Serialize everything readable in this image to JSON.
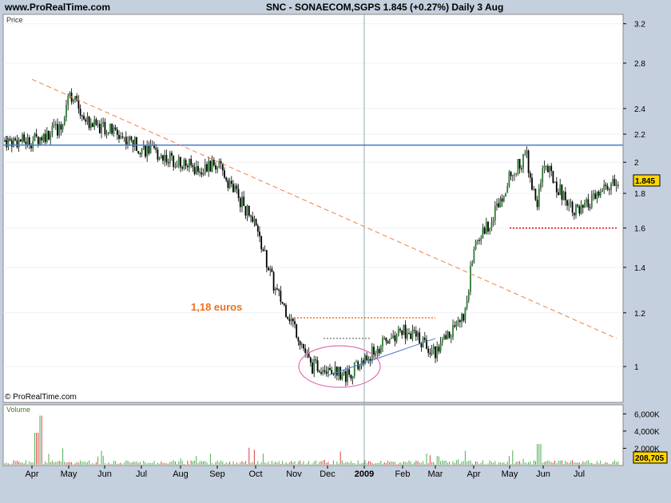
{
  "header": {
    "site": "www.ProRealTime.com",
    "symbol_line": "SNC - SONAECOM,SGPS    1.845 (+0.27%)    Daily  3 Aug"
  },
  "price_panel": {
    "label": "Price",
    "copyright": "© ProRealTime.com",
    "y_ticks": [
      "3.2",
      "2.8",
      "2.4",
      "2.2",
      "2",
      "1.8",
      "1.6",
      "1.4",
      "1.2",
      "1"
    ],
    "last_price": "1.845",
    "clipped_level_label": "2."
  },
  "volume_panel": {
    "label": "Volume",
    "y_ticks": [
      "6,000K",
      "4,000K",
      "2,000K"
    ],
    "last_volume": "208,705"
  },
  "x_axis": {
    "labels": [
      "Apr",
      "May",
      "Jun",
      "Jul",
      "Aug",
      "Sep",
      "Oct",
      "Nov",
      "Dec",
      "2009",
      "Feb",
      "Mar",
      "Apr",
      "May",
      "Jun",
      "Jul"
    ]
  },
  "annotations": {
    "support_label": "1,18 euros"
  },
  "colors": {
    "background": "#c5d0de",
    "panel": "#ffffff",
    "bull_candle": "#2e7d32",
    "horizontal_line": "#4a7bd0",
    "downtrend": "#f08040",
    "support": "#f07020",
    "resistance_dotted": "#e00000",
    "ellipse": "#e070b0",
    "volume_bar": "#4caf50",
    "volume_bar_alt": "#d84040",
    "last_price_box": "#ffd700"
  },
  "chart_data": {
    "type": "candlestick",
    "y_scale": "log",
    "ylim": [
      0.9,
      3.25
    ],
    "x_period": [
      "2008-04",
      "2009-08"
    ],
    "closing_path": [
      {
        "x": "Apr 2008",
        "y": 2.15
      },
      {
        "x": "late Apr 2008",
        "y": 2.25
      },
      {
        "x": "May 2008",
        "y": 2.55
      },
      {
        "x": "mid May 2008",
        "y": 2.3
      },
      {
        "x": "Jun 2008",
        "y": 2.25
      },
      {
        "x": "mid Jun 2008",
        "y": 2.18
      },
      {
        "x": "Jul 2008",
        "y": 2.1
      },
      {
        "x": "mid Jul 2008",
        "y": 2.05
      },
      {
        "x": "Aug 2008",
        "y": 2.0
      },
      {
        "x": "mid Aug 2008",
        "y": 1.95
      },
      {
        "x": "Sep 2008",
        "y": 1.98
      },
      {
        "x": "mid Sep 2008",
        "y": 1.8
      },
      {
        "x": "Oct 2008",
        "y": 1.6
      },
      {
        "x": "mid Oct 2008",
        "y": 1.3
      },
      {
        "x": "Nov 2008",
        "y": 1.15
      },
      {
        "x": "mid Nov 2008",
        "y": 1.0
      },
      {
        "x": "Dec 2008",
        "y": 1.0
      },
      {
        "x": "mid Dec 2008",
        "y": 0.97
      },
      {
        "x": "Jan 2009",
        "y": 1.02
      },
      {
        "x": "mid Jan 2009",
        "y": 1.08
      },
      {
        "x": "Feb 2009",
        "y": 1.13
      },
      {
        "x": "mid Feb 2009",
        "y": 1.1
      },
      {
        "x": "Mar 2009",
        "y": 1.05
      },
      {
        "x": "late Mar 2009",
        "y": 1.2
      },
      {
        "x": "Apr 2009",
        "y": 1.5
      },
      {
        "x": "mid Apr 2009",
        "y": 1.65
      },
      {
        "x": "May 2009",
        "y": 1.9
      },
      {
        "x": "mid May 2009",
        "y": 2.05
      },
      {
        "x": "late May 2009",
        "y": 1.7
      },
      {
        "x": "Jun 2009",
        "y": 2.0
      },
      {
        "x": "mid Jun 2009",
        "y": 1.8
      },
      {
        "x": "Jul 2009",
        "y": 1.68
      },
      {
        "x": "late Jul 2009",
        "y": 1.85
      }
    ],
    "lines": [
      {
        "kind": "horizontal",
        "y": 2.12
      },
      {
        "kind": "horizontal_dotted",
        "y": 1.18,
        "x_from": "Nov 2008",
        "x_to": "Mar 2009"
      },
      {
        "kind": "horizontal_dotted",
        "y": 1.6,
        "x_from": "May 2009",
        "x_to": "Aug 2009"
      },
      {
        "kind": "trend",
        "from": {
          "x": "Apr 2008",
          "y": 2.65
        },
        "to": {
          "x": "Aug 2009",
          "y": 1.1
        }
      },
      {
        "kind": "trend",
        "from": {
          "x": "Dec 2008",
          "y": 0.97
        },
        "to": {
          "x": "Mar 2009",
          "y": 1.1
        }
      }
    ],
    "last_close": 1.845,
    "last_volume": 208705,
    "volume_ylim": [
      0,
      6500
    ]
  }
}
